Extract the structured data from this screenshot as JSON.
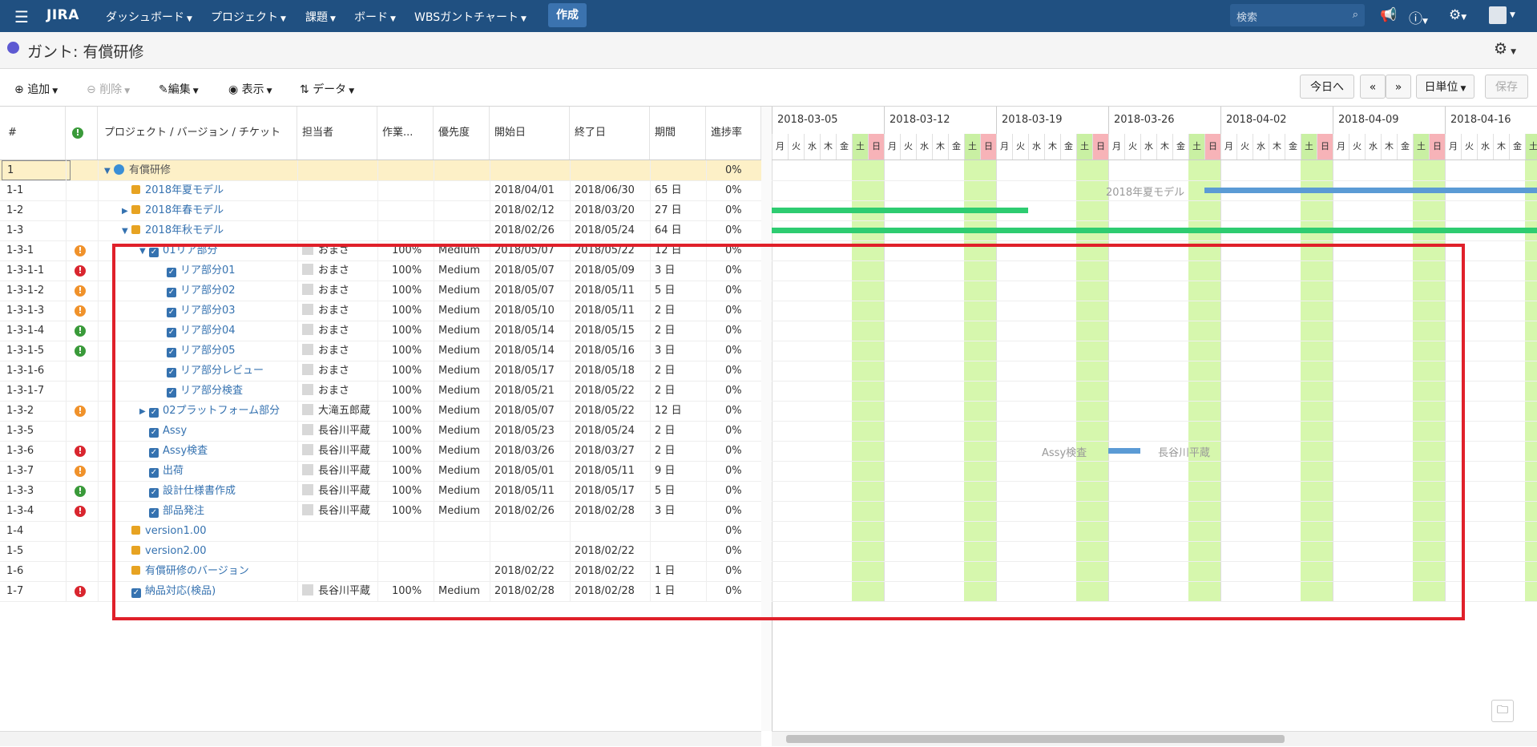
{
  "topbar": {
    "logo": "JIRA",
    "nav": [
      "ダッシュボード",
      "プロジェクト",
      "課題",
      "ボード",
      "WBSガントチャート"
    ],
    "create": "作成",
    "search_placeholder": "検索"
  },
  "page": {
    "title": "ガント: 有償研修"
  },
  "toolbar": {
    "add": "追加",
    "delete": "削除",
    "edit": "編集",
    "view": "表示",
    "data": "データ",
    "today": "今日へ",
    "prev": "«",
    "next": "»",
    "unit": "日単位",
    "save": "保存"
  },
  "columns": [
    "#",
    "プロジェクト / バージョン / チケット",
    "担当者",
    "作業...",
    "優先度",
    "開始日",
    "終了日",
    "期間",
    "進捗率"
  ],
  "rows": [
    {
      "id": "1",
      "name": "有償研修",
      "kind": "project",
      "lvl": 0,
      "tw": "down",
      "assignee": "",
      "work": "",
      "priority": "",
      "start": "",
      "end": "",
      "dur": "",
      "prog": "0%",
      "pri": "",
      "sel": true
    },
    {
      "id": "1-1",
      "name": "2018年夏モデル",
      "kind": "pkg",
      "lvl": 1,
      "tw": "",
      "assignee": "",
      "work": "",
      "priority": "",
      "start": "2018/04/01",
      "end": "2018/06/30",
      "dur": "65 日",
      "prog": "0%",
      "pri": ""
    },
    {
      "id": "1-2",
      "name": "2018年春モデル",
      "kind": "pkg",
      "lvl": 1,
      "tw": "right",
      "assignee": "",
      "work": "",
      "priority": "",
      "start": "2018/02/12",
      "end": "2018/03/20",
      "dur": "27 日",
      "prog": "0%",
      "pri": ""
    },
    {
      "id": "1-3",
      "name": "2018年秋モデル",
      "kind": "pkg",
      "lvl": 1,
      "tw": "down",
      "assignee": "",
      "work": "",
      "priority": "",
      "start": "2018/02/26",
      "end": "2018/05/24",
      "dur": "64 日",
      "prog": "0%",
      "pri": ""
    },
    {
      "id": "1-3-1",
      "name": "01リア部分",
      "kind": "chk",
      "lvl": 2,
      "tw": "down",
      "assignee": "おまさ",
      "work": "100%",
      "priority": "Medium",
      "start": "2018/05/07",
      "end": "2018/05/22",
      "dur": "12 日",
      "prog": "0%",
      "pri": "orange"
    },
    {
      "id": "1-3-1-1",
      "name": "リア部分01",
      "kind": "chk",
      "lvl": 3,
      "tw": "",
      "assignee": "おまさ",
      "work": "100%",
      "priority": "Medium",
      "start": "2018/05/07",
      "end": "2018/05/09",
      "dur": "3 日",
      "prog": "0%",
      "pri": "red"
    },
    {
      "id": "1-3-1-2",
      "name": "リア部分02",
      "kind": "chk",
      "lvl": 3,
      "tw": "",
      "assignee": "おまさ",
      "work": "100%",
      "priority": "Medium",
      "start": "2018/05/07",
      "end": "2018/05/11",
      "dur": "5 日",
      "prog": "0%",
      "pri": "orange"
    },
    {
      "id": "1-3-1-3",
      "name": "リア部分03",
      "kind": "chk",
      "lvl": 3,
      "tw": "",
      "assignee": "おまさ",
      "work": "100%",
      "priority": "Medium",
      "start": "2018/05/10",
      "end": "2018/05/11",
      "dur": "2 日",
      "prog": "0%",
      "pri": "orange"
    },
    {
      "id": "1-3-1-4",
      "name": "リア部分04",
      "kind": "chk",
      "lvl": 3,
      "tw": "",
      "assignee": "おまさ",
      "work": "100%",
      "priority": "Medium",
      "start": "2018/05/14",
      "end": "2018/05/15",
      "dur": "2 日",
      "prog": "0%",
      "pri": "green"
    },
    {
      "id": "1-3-1-5",
      "name": "リア部分05",
      "kind": "chk",
      "lvl": 3,
      "tw": "",
      "assignee": "おまさ",
      "work": "100%",
      "priority": "Medium",
      "start": "2018/05/14",
      "end": "2018/05/16",
      "dur": "3 日",
      "prog": "0%",
      "pri": "green"
    },
    {
      "id": "1-3-1-6",
      "name": "リア部分レビュー",
      "kind": "chk",
      "lvl": 3,
      "tw": "",
      "assignee": "おまさ",
      "work": "100%",
      "priority": "Medium",
      "start": "2018/05/17",
      "end": "2018/05/18",
      "dur": "2 日",
      "prog": "0%",
      "pri": ""
    },
    {
      "id": "1-3-1-7",
      "name": "リア部分検査",
      "kind": "chk",
      "lvl": 3,
      "tw": "",
      "assignee": "おまさ",
      "work": "100%",
      "priority": "Medium",
      "start": "2018/05/21",
      "end": "2018/05/22",
      "dur": "2 日",
      "prog": "0%",
      "pri": ""
    },
    {
      "id": "1-3-2",
      "name": "02プラットフォーム部分",
      "kind": "chk",
      "lvl": 2,
      "tw": "right",
      "assignee": "大滝五郎蔵",
      "work": "100%",
      "priority": "Medium",
      "start": "2018/05/07",
      "end": "2018/05/22",
      "dur": "12 日",
      "prog": "0%",
      "pri": "orange"
    },
    {
      "id": "1-3-5",
      "name": "Assy",
      "kind": "chk",
      "lvl": 2,
      "tw": "",
      "assignee": "長谷川平蔵",
      "work": "100%",
      "priority": "Medium",
      "start": "2018/05/23",
      "end": "2018/05/24",
      "dur": "2 日",
      "prog": "0%",
      "pri": ""
    },
    {
      "id": "1-3-6",
      "name": "Assy検査",
      "kind": "chk",
      "lvl": 2,
      "tw": "",
      "assignee": "長谷川平蔵",
      "work": "100%",
      "priority": "Medium",
      "start": "2018/03/26",
      "end": "2018/03/27",
      "dur": "2 日",
      "prog": "0%",
      "pri": "red"
    },
    {
      "id": "1-3-7",
      "name": "出荷",
      "kind": "chk",
      "lvl": 2,
      "tw": "",
      "assignee": "長谷川平蔵",
      "work": "100%",
      "priority": "Medium",
      "start": "2018/05/01",
      "end": "2018/05/11",
      "dur": "9 日",
      "prog": "0%",
      "pri": "orange"
    },
    {
      "id": "1-3-3",
      "name": "設計仕様書作成",
      "kind": "chk",
      "lvl": 2,
      "tw": "",
      "assignee": "長谷川平蔵",
      "work": "100%",
      "priority": "Medium",
      "start": "2018/05/11",
      "end": "2018/05/17",
      "dur": "5 日",
      "prog": "0%",
      "pri": "green"
    },
    {
      "id": "1-3-4",
      "name": "部品発注",
      "kind": "chk",
      "lvl": 2,
      "tw": "",
      "assignee": "長谷川平蔵",
      "work": "100%",
      "priority": "Medium",
      "start": "2018/02/26",
      "end": "2018/02/28",
      "dur": "3 日",
      "prog": "0%",
      "pri": "red"
    },
    {
      "id": "1-4",
      "name": "version1.00",
      "kind": "pkg",
      "lvl": 1,
      "tw": "",
      "assignee": "",
      "work": "",
      "priority": "",
      "start": "",
      "end": "",
      "dur": "",
      "prog": "0%",
      "pri": ""
    },
    {
      "id": "1-5",
      "name": "version2.00",
      "kind": "pkg",
      "lvl": 1,
      "tw": "",
      "assignee": "",
      "work": "",
      "priority": "",
      "start": "",
      "end": "2018/02/22",
      "dur": "",
      "prog": "0%",
      "pri": ""
    },
    {
      "id": "1-6",
      "name": "有償研修のバージョン",
      "kind": "pkg",
      "lvl": 1,
      "tw": "",
      "assignee": "",
      "work": "",
      "priority": "",
      "start": "2018/02/22",
      "end": "2018/02/22",
      "dur": "1 日",
      "prog": "0%",
      "pri": ""
    },
    {
      "id": "1-7",
      "name": "納品対応(検品)",
      "kind": "chk",
      "lvl": 1,
      "tw": "",
      "assignee": "長谷川平蔵",
      "work": "100%",
      "priority": "Medium",
      "start": "2018/02/28",
      "end": "2018/02/28",
      "dur": "1 日",
      "prog": "0%",
      "pri": "red"
    }
  ],
  "gantt": {
    "weeks": [
      "2018-03-05",
      "2018-03-12",
      "2018-03-19",
      "2018-03-26",
      "2018-04-02",
      "2018-04-09",
      "2018-04-16"
    ],
    "days": [
      "月",
      "火",
      "水",
      "木",
      "金",
      "土",
      "日"
    ],
    "labels": {
      "summer": "2018年夏モデル",
      "assy": "Assy検査",
      "assignee": "長谷川平蔵"
    },
    "colors": {
      "blue": "#5b9bd5",
      "green": "#2ecc71"
    }
  },
  "icons": {
    "folder": "folder-icon"
  }
}
